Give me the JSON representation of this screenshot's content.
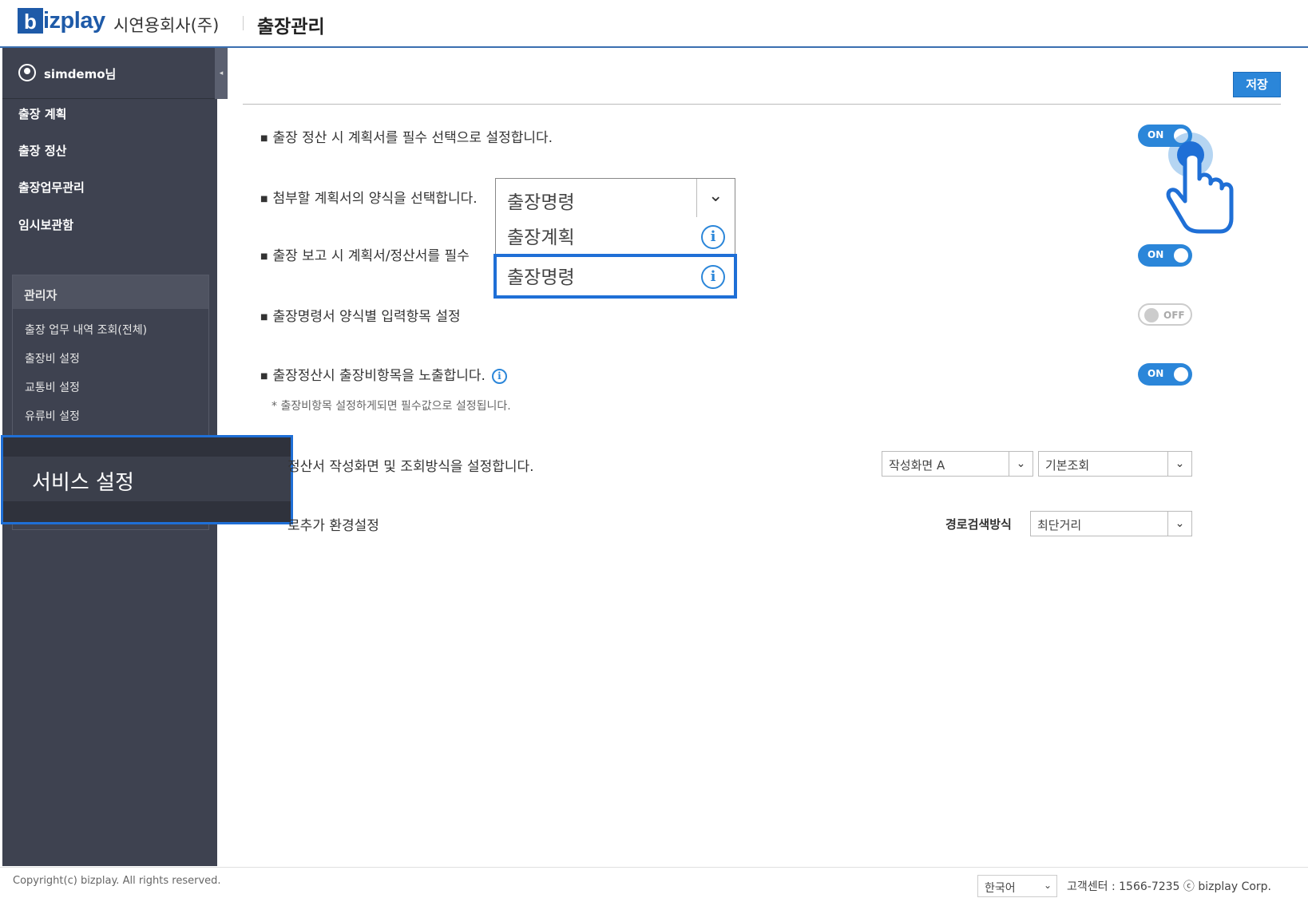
{
  "header": {
    "logo_letter": "b",
    "logo_text": "izplay",
    "company": "시연용회사(주)",
    "title": "출장관리"
  },
  "sidebar": {
    "collapse_glyph": "◂",
    "user": "simdemo님",
    "items": [
      {
        "label": "출장 계획"
      },
      {
        "label": "출장 정산"
      },
      {
        "label": "출장업무관리"
      },
      {
        "label": "임시보관함"
      }
    ],
    "admin": {
      "title": "관리자",
      "items": [
        {
          "label": "출장 업무 내역 조회(전체)"
        },
        {
          "label": "출장비 설정"
        },
        {
          "label": "교통비 설정"
        },
        {
          "label": "유류비 설정"
        }
      ]
    },
    "service_settings": "서비스 설정"
  },
  "main": {
    "save_label": "저장",
    "options": [
      {
        "text": "출장 정산 시 계획서를 필수 선택으로 설정합니다.",
        "toggle": "ON"
      },
      {
        "text": "첨부할 계획서의 양식을 선택합니다."
      },
      {
        "text": "출장 보고 시 계획서/정산서를 필수 ",
        "toggle": "ON"
      },
      {
        "text": "출장명령서 양식별 입력항목 설정",
        "toggle": "OFF"
      },
      {
        "text": "출장정산시 출장비항목을 노출합니다.",
        "toggle": "ON"
      },
      {
        "text": "정산서 작성화면 및 조회방식을 설정합니다."
      },
      {
        "text": "로추가 환경설정"
      }
    ],
    "note": "* 출장비항목 설정하게되면 필수값으로 설정됩니다.",
    "dropdown": {
      "selected": "출장명령",
      "options": [
        "출장계획",
        "출장명령"
      ],
      "highlighted": "출장명령"
    },
    "write_screen": "작성화면 A",
    "view_mode": "기본조회",
    "route_label": "경로검색방식",
    "route_value": "최단거리"
  },
  "footer": {
    "copyright": "Copyright(c) bizplay. All rights reserved.",
    "language": "한국어",
    "customer_center": "고객센터 : 1566-7235 ⓒ bizplay Corp."
  },
  "colors": {
    "accent": "#2b86d9",
    "highlight": "#1f6fd6",
    "sidebar": "#3e4250"
  }
}
